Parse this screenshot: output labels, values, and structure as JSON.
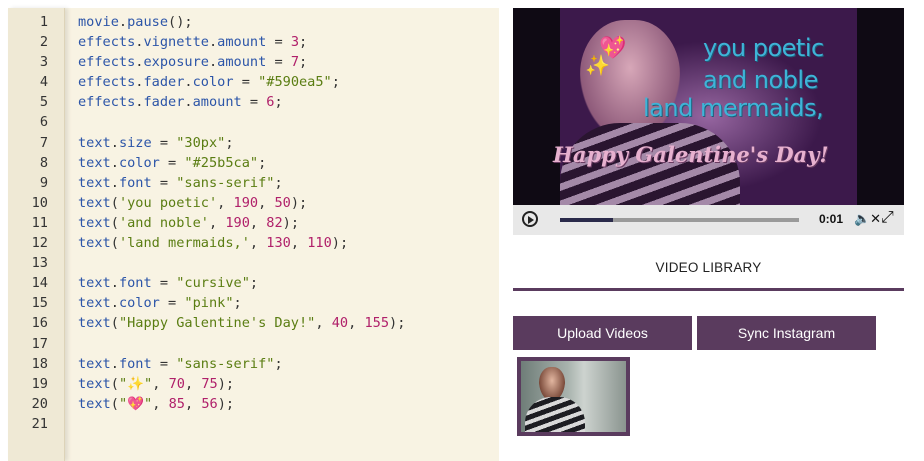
{
  "editor": {
    "lines": [
      {
        "n": "1",
        "tokens": [
          {
            "c": "t-id",
            "t": "movie"
          },
          {
            "c": "t-p",
            "t": "."
          },
          {
            "c": "t-id",
            "t": "pause"
          },
          {
            "c": "t-p",
            "t": "();"
          }
        ]
      },
      {
        "n": "2",
        "tokens": [
          {
            "c": "t-id",
            "t": "effects"
          },
          {
            "c": "t-p",
            "t": "."
          },
          {
            "c": "t-id",
            "t": "vignette"
          },
          {
            "c": "t-p",
            "t": "."
          },
          {
            "c": "t-id",
            "t": "amount"
          },
          {
            "c": "t-p",
            "t": " = "
          },
          {
            "c": "t-n",
            "t": "3"
          },
          {
            "c": "t-p",
            "t": ";"
          }
        ]
      },
      {
        "n": "3",
        "tokens": [
          {
            "c": "t-id",
            "t": "effects"
          },
          {
            "c": "t-p",
            "t": "."
          },
          {
            "c": "t-id",
            "t": "exposure"
          },
          {
            "c": "t-p",
            "t": "."
          },
          {
            "c": "t-id",
            "t": "amount"
          },
          {
            "c": "t-p",
            "t": " = "
          },
          {
            "c": "t-n",
            "t": "7"
          },
          {
            "c": "t-p",
            "t": ";"
          }
        ]
      },
      {
        "n": "4",
        "tokens": [
          {
            "c": "t-id",
            "t": "effects"
          },
          {
            "c": "t-p",
            "t": "."
          },
          {
            "c": "t-id",
            "t": "fader"
          },
          {
            "c": "t-p",
            "t": "."
          },
          {
            "c": "t-id",
            "t": "color"
          },
          {
            "c": "t-p",
            "t": " = "
          },
          {
            "c": "t-s",
            "t": "\"#590ea5\""
          },
          {
            "c": "t-p",
            "t": ";"
          }
        ]
      },
      {
        "n": "5",
        "tokens": [
          {
            "c": "t-id",
            "t": "effects"
          },
          {
            "c": "t-p",
            "t": "."
          },
          {
            "c": "t-id",
            "t": "fader"
          },
          {
            "c": "t-p",
            "t": "."
          },
          {
            "c": "t-id",
            "t": "amount"
          },
          {
            "c": "t-p",
            "t": " = "
          },
          {
            "c": "t-n",
            "t": "6"
          },
          {
            "c": "t-p",
            "t": ";"
          }
        ]
      },
      {
        "n": "6",
        "tokens": []
      },
      {
        "n": "7",
        "tokens": [
          {
            "c": "t-id",
            "t": "text"
          },
          {
            "c": "t-p",
            "t": "."
          },
          {
            "c": "t-id",
            "t": "size"
          },
          {
            "c": "t-p",
            "t": " = "
          },
          {
            "c": "t-s",
            "t": "\"30px\""
          },
          {
            "c": "t-p",
            "t": ";"
          }
        ]
      },
      {
        "n": "8",
        "tokens": [
          {
            "c": "t-id",
            "t": "text"
          },
          {
            "c": "t-p",
            "t": "."
          },
          {
            "c": "t-id",
            "t": "color"
          },
          {
            "c": "t-p",
            "t": " = "
          },
          {
            "c": "t-s",
            "t": "\"#25b5ca\""
          },
          {
            "c": "t-p",
            "t": ";"
          }
        ]
      },
      {
        "n": "9",
        "tokens": [
          {
            "c": "t-id",
            "t": "text"
          },
          {
            "c": "t-p",
            "t": "."
          },
          {
            "c": "t-id",
            "t": "font"
          },
          {
            "c": "t-p",
            "t": " = "
          },
          {
            "c": "t-s",
            "t": "\"sans-serif\""
          },
          {
            "c": "t-p",
            "t": ";"
          }
        ]
      },
      {
        "n": "10",
        "tokens": [
          {
            "c": "t-id",
            "t": "text"
          },
          {
            "c": "t-p",
            "t": "("
          },
          {
            "c": "t-s",
            "t": "'you poetic'"
          },
          {
            "c": "t-p",
            "t": ", "
          },
          {
            "c": "t-n",
            "t": "190"
          },
          {
            "c": "t-p",
            "t": ", "
          },
          {
            "c": "t-n",
            "t": "50"
          },
          {
            "c": "t-p",
            "t": ");"
          }
        ]
      },
      {
        "n": "11",
        "tokens": [
          {
            "c": "t-id",
            "t": "text"
          },
          {
            "c": "t-p",
            "t": "("
          },
          {
            "c": "t-s",
            "t": "'and noble'"
          },
          {
            "c": "t-p",
            "t": ", "
          },
          {
            "c": "t-n",
            "t": "190"
          },
          {
            "c": "t-p",
            "t": ", "
          },
          {
            "c": "t-n",
            "t": "82"
          },
          {
            "c": "t-p",
            "t": ");"
          }
        ]
      },
      {
        "n": "12",
        "tokens": [
          {
            "c": "t-id",
            "t": "text"
          },
          {
            "c": "t-p",
            "t": "("
          },
          {
            "c": "t-s",
            "t": "'land mermaids,'"
          },
          {
            "c": "t-p",
            "t": ", "
          },
          {
            "c": "t-n",
            "t": "130"
          },
          {
            "c": "t-p",
            "t": ", "
          },
          {
            "c": "t-n",
            "t": "110"
          },
          {
            "c": "t-p",
            "t": ");"
          }
        ]
      },
      {
        "n": "13",
        "tokens": []
      },
      {
        "n": "14",
        "tokens": [
          {
            "c": "t-id",
            "t": "text"
          },
          {
            "c": "t-p",
            "t": "."
          },
          {
            "c": "t-id",
            "t": "font"
          },
          {
            "c": "t-p",
            "t": " = "
          },
          {
            "c": "t-s",
            "t": "\"cursive\""
          },
          {
            "c": "t-p",
            "t": ";"
          }
        ]
      },
      {
        "n": "15",
        "tokens": [
          {
            "c": "t-id",
            "t": "text"
          },
          {
            "c": "t-p",
            "t": "."
          },
          {
            "c": "t-id",
            "t": "color"
          },
          {
            "c": "t-p",
            "t": " = "
          },
          {
            "c": "t-s",
            "t": "\"pink\""
          },
          {
            "c": "t-p",
            "t": ";"
          }
        ]
      },
      {
        "n": "16",
        "tokens": [
          {
            "c": "t-id",
            "t": "text"
          },
          {
            "c": "t-p",
            "t": "("
          },
          {
            "c": "t-s",
            "t": "\"Happy Galentine's Day!\""
          },
          {
            "c": "t-p",
            "t": ", "
          },
          {
            "c": "t-n",
            "t": "40"
          },
          {
            "c": "t-p",
            "t": ", "
          },
          {
            "c": "t-n",
            "t": "155"
          },
          {
            "c": "t-p",
            "t": ");"
          }
        ]
      },
      {
        "n": "17",
        "tokens": []
      },
      {
        "n": "18",
        "tokens": [
          {
            "c": "t-id",
            "t": "text"
          },
          {
            "c": "t-p",
            "t": "."
          },
          {
            "c": "t-id",
            "t": "font"
          },
          {
            "c": "t-p",
            "t": " = "
          },
          {
            "c": "t-s",
            "t": "\"sans-serif\""
          },
          {
            "c": "t-p",
            "t": ";"
          }
        ]
      },
      {
        "n": "19",
        "tokens": [
          {
            "c": "t-id",
            "t": "text"
          },
          {
            "c": "t-p",
            "t": "("
          },
          {
            "c": "t-s",
            "t": "\"✨\""
          },
          {
            "c": "t-p",
            "t": ", "
          },
          {
            "c": "t-n",
            "t": "70"
          },
          {
            "c": "t-p",
            "t": ", "
          },
          {
            "c": "t-n",
            "t": "75"
          },
          {
            "c": "t-p",
            "t": ");"
          }
        ]
      },
      {
        "n": "20",
        "tokens": [
          {
            "c": "t-id",
            "t": "text"
          },
          {
            "c": "t-p",
            "t": "("
          },
          {
            "c": "t-s",
            "t": "\"💖\""
          },
          {
            "c": "t-p",
            "t": ", "
          },
          {
            "c": "t-n",
            "t": "85"
          },
          {
            "c": "t-p",
            "t": ", "
          },
          {
            "c": "t-n",
            "t": "56"
          },
          {
            "c": "t-p",
            "t": ");"
          }
        ]
      },
      {
        "n": "21",
        "tokens": []
      }
    ]
  },
  "player": {
    "overlay": {
      "line1": "you poetic",
      "line2": "and noble",
      "line3": "land mermaids,",
      "cursive": "Happy Galentine's Day!",
      "sparkles": "✨",
      "heart": "💖"
    },
    "time": "0:01",
    "progress": 0.22,
    "mute_icon": "mute-icon",
    "fullscreen_icon": "fullscreen-icon"
  },
  "library": {
    "title": "VIDEO LIBRARY",
    "upload_label": "Upload Videos",
    "sync_label": "Sync Instagram"
  },
  "colors": {
    "accent": "#5a3b5e",
    "text_color": "#25b5ca",
    "fader_color": "#590ea5"
  }
}
